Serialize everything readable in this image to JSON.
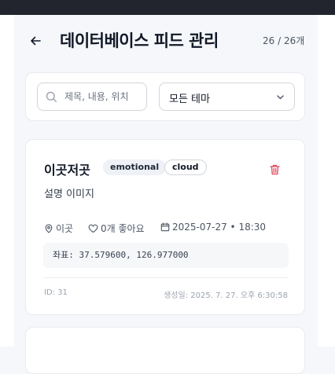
{
  "header": {
    "back_icon": "arrow-left-icon",
    "title": "데이터베이스 피드 관리",
    "count": "26 / 26개"
  },
  "filters": {
    "search_placeholder": "제목, 내용, 위치",
    "search_value": "",
    "search_icon": "search-icon",
    "theme_selected": "모든 테마",
    "theme_icon": "chevron-down-icon"
  },
  "feed": {
    "title": "이곳저곳",
    "tags": [
      "emotional",
      "cloud"
    ],
    "description": "설명 이미지",
    "location": "이곳",
    "likes": "0개 좋아요",
    "date": "2025-07-27 • 18:30",
    "coords": "좌표: 37.579600, 126.977000",
    "id": "ID: 31",
    "created": "생성일: 2025. 7. 27. 오후 6:30:58"
  },
  "colors": {
    "topbar": "#22252e",
    "delete": "#e0475a",
    "muted_text": "#9ca3af"
  }
}
